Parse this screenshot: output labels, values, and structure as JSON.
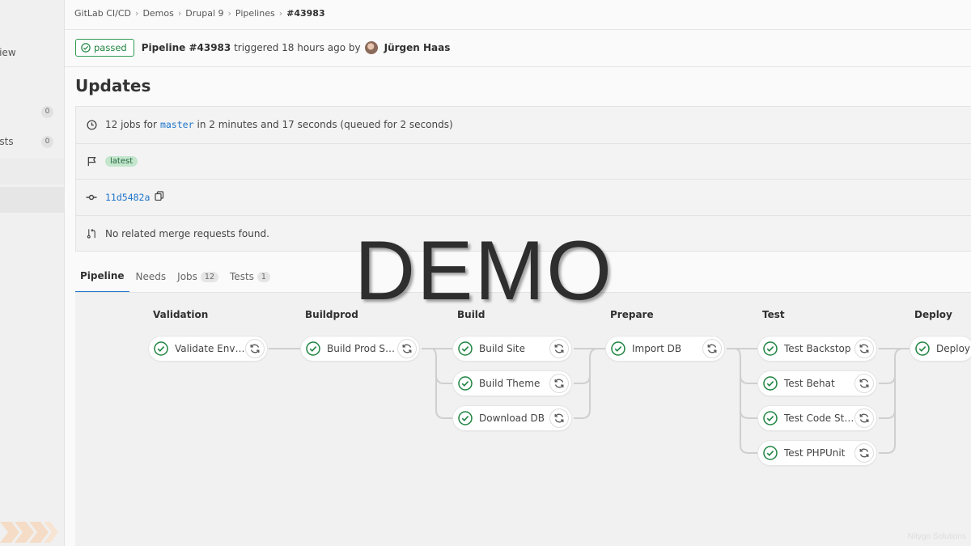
{
  "sidebar": {
    "items": [
      {
        "label": "view"
      },
      {
        "label": "",
        "count": "0"
      },
      {
        "label": "ests",
        "count": "0"
      }
    ]
  },
  "breadcrumb": [
    "GitLab CI/CD",
    "Demos",
    "Drupal 9",
    "Pipelines",
    "#43983"
  ],
  "status": {
    "badge": "passed",
    "pipeline_label": "Pipeline #43983",
    "triggered_text": " triggered 18 hours ago by ",
    "author": "Jürgen Haas"
  },
  "title": "Updates",
  "info": {
    "jobs_prefix": "12 jobs for ",
    "branch": "master",
    "jobs_suffix": " in 2 minutes and 17 seconds (queued for 2 seconds)",
    "tag": "latest",
    "commit": "11d5482a",
    "merge_requests": "No related merge requests found."
  },
  "tabs": [
    {
      "label": "Pipeline",
      "active": true
    },
    {
      "label": "Needs"
    },
    {
      "label": "Jobs",
      "count": "12"
    },
    {
      "label": "Tests",
      "count": "1"
    }
  ],
  "stages": [
    {
      "name": "Validation",
      "jobs": [
        "Validate Envir..."
      ]
    },
    {
      "name": "Buildprod",
      "jobs": [
        "Build Prod Site"
      ]
    },
    {
      "name": "Build",
      "jobs": [
        "Build Site",
        "Build Theme",
        "Download DB"
      ]
    },
    {
      "name": "Prepare",
      "jobs": [
        "Import DB"
      ]
    },
    {
      "name": "Test",
      "jobs": [
        "Test Backstop",
        "Test Behat",
        "Test Code Style",
        "Test PHPUnit"
      ]
    },
    {
      "name": "Deploy",
      "jobs": [
        "Deploy"
      ]
    }
  ],
  "watermark": "DEMO",
  "corner_mark": "Nitygo Solutions",
  "colors": {
    "success": "#1f8440",
    "link": "#1f75cb"
  }
}
